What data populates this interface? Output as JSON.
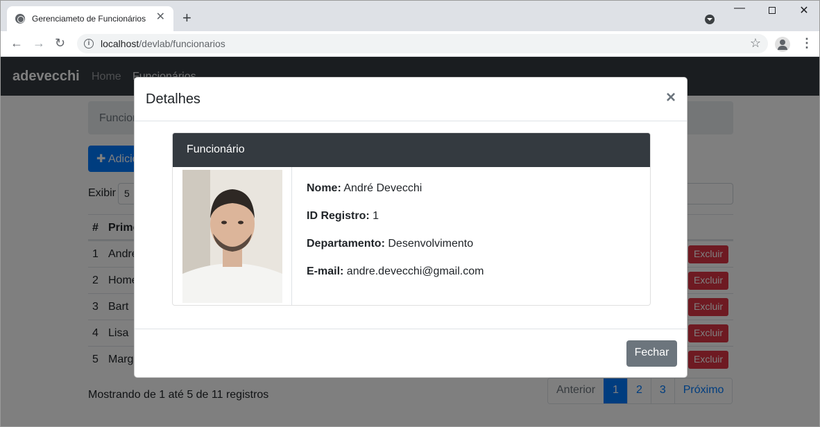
{
  "browser": {
    "tab_title": "Gerenciameto de Funcionários",
    "url_host": "localhost",
    "url_path": "/devlab/funcionarios"
  },
  "app": {
    "brand": "adevecchi",
    "nav": [
      "Home",
      "Funcionários"
    ],
    "breadcrumb": "Funcionários",
    "add_button": "✚ Adicionar",
    "show_label": "Exibir",
    "show_value": "5",
    "table_headers": {
      "num": "#",
      "first": "Primeiro Nome"
    },
    "rows": [
      {
        "id": "1",
        "name": "André",
        "delete": "Excluir"
      },
      {
        "id": "2",
        "name": "Homer",
        "delete": "Excluir"
      },
      {
        "id": "3",
        "name": "Bart",
        "delete": "Excluir"
      },
      {
        "id": "4",
        "name": "Lisa",
        "delete": "Excluir"
      },
      {
        "id": "5",
        "name": "Marge",
        "delete": "Excluir"
      }
    ],
    "footer_info": "Mostrando de 1 até 5 de 11 registros",
    "pagination": [
      "Anterior",
      "1",
      "2",
      "3",
      "Próximo"
    ]
  },
  "modal": {
    "title": "Detalhes",
    "close_symbol": "×",
    "card_header": "Funcionário",
    "fields": [
      {
        "label": "Nome:",
        "value": "André Devecchi"
      },
      {
        "label": "ID Registro:",
        "value": "1"
      },
      {
        "label": "Departamento:",
        "value": "Desenvolvimento"
      },
      {
        "label": "E-mail:",
        "value": "andre.devecchi@gmail.com"
      }
    ],
    "close_button": "Fechar"
  }
}
